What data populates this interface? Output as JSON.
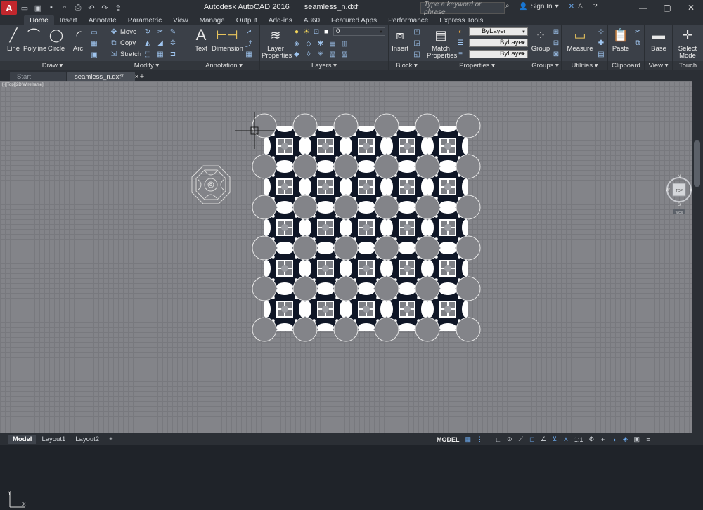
{
  "window": {
    "app_title": "Autodesk AutoCAD 2016",
    "file_title": "seamless_n.dxf"
  },
  "search": {
    "placeholder": "Type a keyword or phrase"
  },
  "account": {
    "signin_label": "Sign In"
  },
  "ribbon_tabs": [
    "Home",
    "Insert",
    "Annotate",
    "Parametric",
    "View",
    "Manage",
    "Output",
    "Add-ins",
    "A360",
    "Featured Apps",
    "Performance",
    "Express Tools"
  ],
  "ribbon": {
    "draw": {
      "title": "Draw",
      "line": "Line",
      "polyline": "Polyline",
      "circle": "Circle",
      "arc": "Arc"
    },
    "modify": {
      "title": "Modify",
      "move": "Move",
      "copy": "Copy",
      "stretch": "Stretch"
    },
    "annotation": {
      "title": "Annotation",
      "text": "Text",
      "dimension": "Dimension"
    },
    "layers": {
      "title": "Layers",
      "layer_properties_1": "Layer",
      "layer_properties_2": "Properties",
      "current_layer": "0"
    },
    "block": {
      "title": "Block",
      "insert": "Insert"
    },
    "properties": {
      "title": "Properties",
      "match_1": "Match",
      "match_2": "Properties",
      "color": "ByLayer",
      "linetype": "ByLayer",
      "lineweight": "ByLayer"
    },
    "groups": {
      "title": "Groups",
      "group": "Group"
    },
    "utilities": {
      "title": "Utilities",
      "measure": "Measure"
    },
    "clipboard": {
      "title": "Clipboard",
      "paste": "Paste"
    },
    "view": {
      "title": "View",
      "base": "Base"
    },
    "touch": {
      "title": "Touch",
      "select_1": "Select",
      "select_2": "Mode"
    }
  },
  "file_tabs": {
    "start": "Start",
    "drawing": "seamless_n.dxf*"
  },
  "viewport": {
    "label": "[-][Top][2D Wireframe]"
  },
  "navcube": {
    "north": "N",
    "south": "S",
    "east": "E",
    "west": "W",
    "face": "TOP",
    "wcs": "WCS"
  },
  "layout_tabs": [
    "Model",
    "Layout1",
    "Layout2"
  ],
  "status": {
    "model_label": "MODEL",
    "scale": "1:1"
  },
  "colors": {
    "accent": "#6aa7ea",
    "pattern_dark": "#0f1626",
    "grid_bg": "#838489"
  }
}
